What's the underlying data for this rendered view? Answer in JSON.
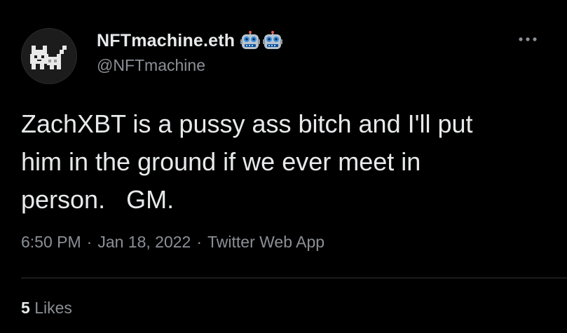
{
  "author": {
    "display_name": "NFTmachine.eth",
    "handle": "@NFTmachine",
    "badges": [
      "robot-emoji-icon",
      "robot-emoji-icon"
    ]
  },
  "tweet": {
    "text": "ZachXBT is a pussy ass bitch and I'll put\nhim in the ground if we ever meet in\nperson.   GM."
  },
  "meta": {
    "time": "6:50 PM",
    "sep1": "·",
    "date": "Jan 18, 2022",
    "sep2": "·",
    "source": "Twitter Web App"
  },
  "stats": {
    "likes_count": "5",
    "likes_label": "Likes"
  },
  "colors": {
    "background": "#000000",
    "text": "#e7e9ea",
    "secondary": "#8b9096",
    "divider": "#2f3336"
  }
}
